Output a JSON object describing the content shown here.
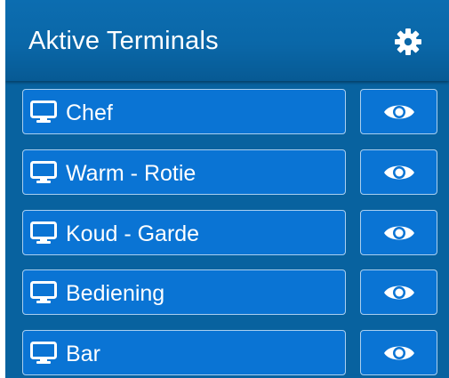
{
  "header": {
    "title": "Aktive Terminals",
    "settings_icon": "gear-icon"
  },
  "terminals": [
    {
      "label": "Chef",
      "icon": "monitor-icon",
      "action_icon": "eye-icon"
    },
    {
      "label": "Warm - Rotie",
      "icon": "monitor-icon",
      "action_icon": "eye-icon"
    },
    {
      "label": "Koud - Garde",
      "icon": "monitor-icon",
      "action_icon": "eye-icon"
    },
    {
      "label": "Bediening",
      "icon": "monitor-icon",
      "action_icon": "eye-icon"
    },
    {
      "label": "Bar",
      "icon": "monitor-icon",
      "action_icon": "eye-icon"
    }
  ],
  "colors": {
    "panel_background": "#08629f",
    "header_background": "#0a67a8",
    "button_background": "#0a74d4",
    "button_border": "#a9cff0",
    "text": "#ffffff"
  }
}
